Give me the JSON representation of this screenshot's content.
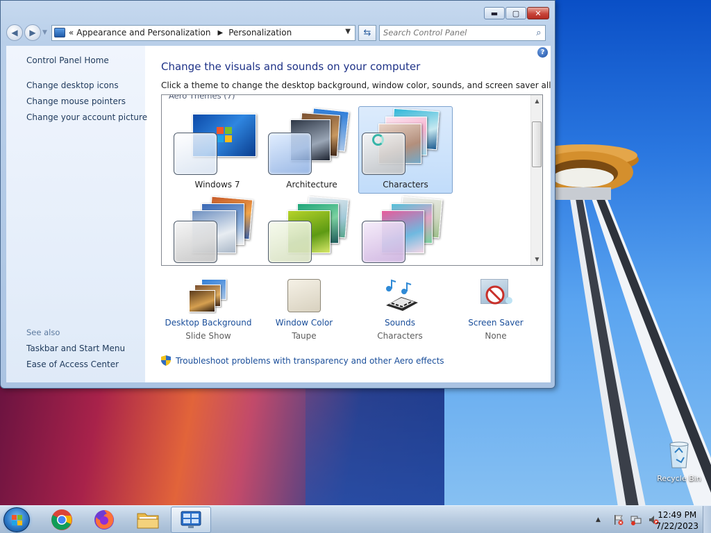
{
  "window": {
    "caption_buttons": {
      "minimize": "▬",
      "maximize": "▢",
      "close": "✕"
    },
    "nav": {
      "back": "◀",
      "forward": "▶"
    },
    "address": {
      "prefix": "«",
      "crumbs": [
        "Appearance and Personalization",
        "Personalization"
      ],
      "separator": "▶"
    },
    "search": {
      "placeholder": "Search Control Panel"
    }
  },
  "sidebar": {
    "home": "Control Panel Home",
    "links": [
      "Change desktop icons",
      "Change mouse pointers",
      "Change your account picture"
    ],
    "see_also_label": "See also",
    "see_also": [
      "Taskbar and Start Menu",
      "Ease of Access Center"
    ]
  },
  "main": {
    "title": "Change the visuals and sounds on your computer",
    "description": "Click a theme to change the desktop background, window color, sounds, and screen saver all at once.",
    "group_label": "Aero Themes (7)",
    "themes": [
      {
        "name": "Windows 7"
      },
      {
        "name": "Architecture"
      },
      {
        "name": "Characters",
        "selected": true
      },
      {
        "name": ""
      },
      {
        "name": ""
      },
      {
        "name": ""
      }
    ],
    "tools": [
      {
        "label": "Desktop Background",
        "value": "Slide Show"
      },
      {
        "label": "Window Color",
        "value": "Taupe"
      },
      {
        "label": "Sounds",
        "value": "Characters"
      },
      {
        "label": "Screen Saver",
        "value": "None"
      }
    ],
    "troubleshoot": "Troubleshoot problems with transparency and other Aero effects"
  },
  "desktop": {
    "recycle_bin": "Recycle Bin"
  },
  "taskbar": {
    "apps": [
      "Google Chrome",
      "Firefox",
      "Windows Explorer",
      "Control Panel"
    ],
    "clock_time": "12:49 PM",
    "clock_date": "7/22/2023"
  },
  "colors": {
    "link": "#1a4e9a",
    "title": "#1e3287",
    "selection": "#c1dcfa"
  }
}
